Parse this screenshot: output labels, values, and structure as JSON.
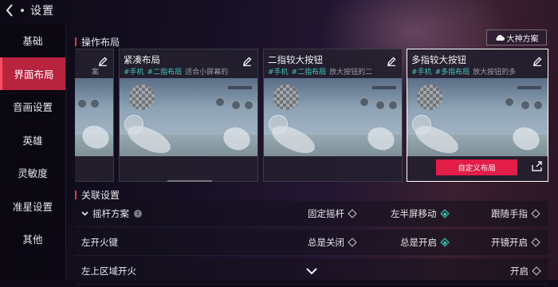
{
  "header": {
    "title": "设置"
  },
  "sidebar": {
    "items": [
      {
        "label": "基础",
        "active": false
      },
      {
        "label": "界面布局",
        "active": true
      },
      {
        "label": "音画设置",
        "active": false
      },
      {
        "label": "英雄",
        "active": false
      },
      {
        "label": "灵敏度",
        "active": false
      },
      {
        "label": "准星设置",
        "active": false
      },
      {
        "label": "其他",
        "active": false
      }
    ]
  },
  "layouts_section": {
    "title": "操作布局",
    "master_button": "大神方案",
    "cards": [
      {
        "name": "",
        "tags": [],
        "desc": "案",
        "selected": false
      },
      {
        "name": "紧凑布局",
        "tags": [
          "#手机",
          "#二指布局"
        ],
        "desc": "适合小屏幕的",
        "selected": false
      },
      {
        "name": "二指较大按钮",
        "tags": [
          "#手机",
          "#二指布局"
        ],
        "desc": "放大按钮的二",
        "selected": false
      },
      {
        "name": "多指较大按钮",
        "tags": [
          "#手机",
          "#多指布局"
        ],
        "desc": "放大按钮的多",
        "selected": true,
        "action_label": "自定义布局"
      }
    ]
  },
  "related_section": {
    "title": "关联设置",
    "rows": [
      {
        "label": "摇杆方案",
        "expandable": true,
        "info": true,
        "options": [
          {
            "label": "固定摇杆",
            "on": false
          },
          {
            "label": "左半屏移动",
            "on": true
          },
          {
            "label": "跟随手指",
            "on": false
          }
        ]
      },
      {
        "label": "左开火键",
        "options": [
          {
            "label": "总是关闭",
            "on": false
          },
          {
            "label": "总是开启",
            "on": true
          },
          {
            "label": "开镜开启",
            "on": false
          }
        ]
      },
      {
        "label": "左上区域开火",
        "options": [
          {
            "label": "开启",
            "on": false
          }
        ]
      }
    ]
  },
  "colors": {
    "accent": "#b8233e",
    "button": "#e21d48",
    "toggle_on": "#3fd0c2"
  }
}
